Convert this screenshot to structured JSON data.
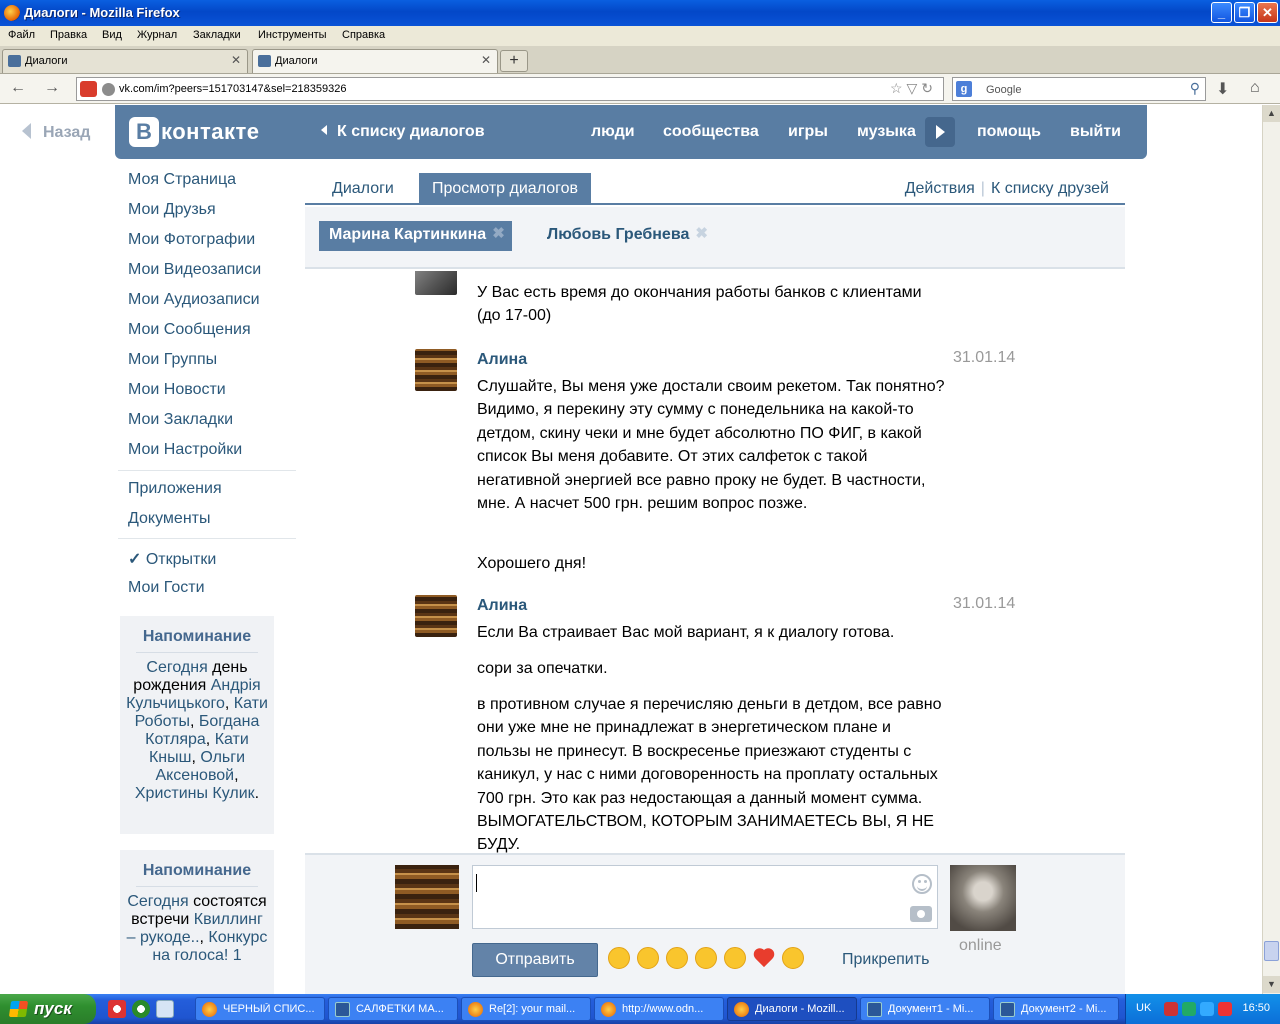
{
  "window": {
    "title": "Диалоги - Mozilla Firefox",
    "min": "_",
    "max": "❐",
    "close": "✕"
  },
  "menu": [
    "Файл",
    "Правка",
    "Вид",
    "Журнал",
    "Закладки",
    "Инструменты",
    "Справка"
  ],
  "tabs": [
    {
      "label": "Диалоги",
      "close": "✕"
    },
    {
      "label": "Диалоги",
      "close": "✕"
    }
  ],
  "newtab": "+",
  "nav": {
    "back": "←",
    "forward": "→",
    "url": "vk.com/im?peers=151703147&sel=218359326",
    "url_icons": "☆▽↻",
    "search_placeholder": "Google",
    "search_engine_letter": "g",
    "search_icon": "⚲",
    "download": "⬇",
    "home": "⌂"
  },
  "page": {
    "back_link": "Назад",
    "header": {
      "logo_mark": "В",
      "logo_text": "контакте",
      "back_to_list": "К списку диалогов",
      "links": [
        "люди",
        "сообщества",
        "игры",
        "музыка",
        "помощь",
        "выйти"
      ]
    },
    "left_menu": {
      "items": [
        "Моя Страница",
        "Мои Друзья",
        "Мои Фотографии",
        "Мои Видеозаписи",
        "Мои Аудиозаписи",
        "Мои Сообщения",
        "Мои Группы",
        "Мои Новости",
        "Мои Закладки",
        "Мои Настройки"
      ],
      "apps": [
        "Приложения",
        "Документы"
      ],
      "postcards_check": "✓",
      "postcards": "Открытки",
      "guests": "Мои Гости"
    },
    "reminder1": {
      "title": "Напоминание",
      "today": "Сегодня",
      "text1": " день рождения ",
      "names": [
        "Андрія Кульчицького",
        "Кати Роботы",
        "Богдана Котляра",
        "Кати Кныш",
        "Ольги Аксеновой",
        "Христины Кулик"
      ],
      "sep": ", ",
      "end": "."
    },
    "reminder2": {
      "title": "Напоминание",
      "today": "Сегодня",
      "text1": " состоятся встречи ",
      "link1": "Квиллинг – рукоде..",
      "sep": ", ",
      "link2": "Конкурс на голоса! 1"
    },
    "dialog_tabs": {
      "tab1": "Диалоги",
      "tab2": "Просмотр диалогов",
      "action1": "Действия",
      "divider": "|",
      "action2": "К списку друзей"
    },
    "peers": [
      {
        "name": "Марина Картинкина",
        "close": "✖"
      },
      {
        "name": "Любовь Гребнева",
        "close": "✖"
      }
    ],
    "messages": [
      {
        "author": "",
        "date": "",
        "paragraphs": [
          "У Вас есть время до окончания работы банков с клиентами (до 17-00)"
        ]
      },
      {
        "author": "Алина",
        "date": "31.01.14",
        "paragraphs": [
          "Слушайте, Вы меня уже достали своим рекетом. Так понятно? Видимо, я перекину эту сумму с понедельника на какой-то детдом, скину чеки и мне будет абсолютно ПО ФИГ, в какой список Вы меня добавите. От этих салфеток с такой негативной энергией все равно проку не будет. В частности, мне. А насчет 500 грн. решим вопрос позже.",
          "Хорошего дня!"
        ]
      },
      {
        "author": "Алина",
        "date": "31.01.14",
        "paragraphs": [
          "Если Ва страивает Вас мой вариант, я к диалогу готова.",
          "сори за опечатки.",
          "в противном случае я перечисляю деньги в детдом, все равно они уже мне не принадлежат в энергетическом плане и пользы не принесут. В воскресенье приезжают студенты с каникул, у нас с ними договоренность на проплату остальных 700 грн. Это как раз недостающая а данный момент сумма. ВЫМОГАТЕЛЬСТВОМ, КОТОРЫМ ЗАНИМАЕТЕСЬ ВЫ, Я НЕ БУДУ."
        ]
      }
    ],
    "compose": {
      "send": "Отправить",
      "attach": "Прикрепить",
      "online": "online",
      "emojis": [
        "smile",
        "tongue",
        "eyes",
        "relieved",
        "cry",
        "heart",
        "roll-eyes"
      ]
    }
  },
  "taskbar": {
    "start": "пуск",
    "buttons": [
      "ЧЕРНЫЙ СПИС...",
      "САЛФЕТКИ МА...",
      "Re[2]: your mail...",
      "http://www.odn...",
      "Диалоги - Mozill...",
      "Документ1 - Mi...",
      "Документ2 - Mi..."
    ],
    "lang": "UK",
    "clock": "16:50"
  }
}
